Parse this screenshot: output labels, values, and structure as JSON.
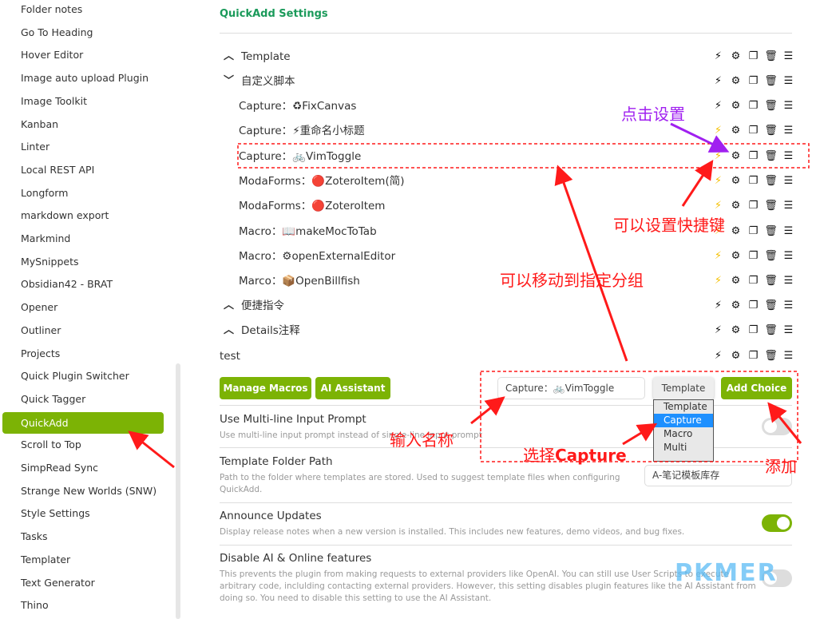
{
  "sidebar": {
    "items": [
      "Folder notes",
      "Go To Heading",
      "Hover Editor",
      "Image auto upload Plugin",
      "Image Toolkit",
      "Kanban",
      "Linter",
      "Local REST API",
      "Longform",
      "markdown export",
      "Markmind",
      "MySnippets",
      "Obsidian42 - BRAT",
      "Opener",
      "Outliner",
      "Projects",
      "Quick Plugin Switcher",
      "Quick Tagger",
      "QuickAdd",
      "Scroll to Top",
      "SimpRead Sync",
      "Strange New Worlds (SNW)",
      "Style Settings",
      "Tasks",
      "Templater",
      "Text Generator",
      "Thino"
    ],
    "active": "QuickAdd"
  },
  "main": {
    "title": "QuickAdd Settings",
    "choices": [
      {
        "chev": "^",
        "label": "Template"
      },
      {
        "chev": "v",
        "label": "自定义脚本"
      },
      {
        "label": "Capture：",
        "emoji": "♻",
        "name": "FixCanvas"
      },
      {
        "label": "Capture：",
        "emoji": "⚡",
        "name": "重命名小标题"
      },
      {
        "label": "Capture：",
        "emoji": "🚲",
        "name": "VimToggle"
      },
      {
        "label": "ModaForms：",
        "emoji": "🔴",
        "name": "ZoteroItem(简)"
      },
      {
        "label": "ModaForms：",
        "emoji": "🔴",
        "name": "ZoteroItem"
      },
      {
        "label": "Macro：",
        "emoji": "📖",
        "name": "makeMocToTab"
      },
      {
        "label": "Macro：",
        "emoji": "⚙",
        "name": "openExternalEditor"
      },
      {
        "label": "Marco：",
        "emoji": "📦",
        "name": "OpenBillfish"
      },
      {
        "chev": "^",
        "label": "便捷指令"
      },
      {
        "chev": "^",
        "label": "Details注释"
      },
      {
        "label": "test"
      }
    ],
    "buttons": {
      "manage_macros": "Manage Macros",
      "ai_assistant": "AI Assistant",
      "add_choice": "Add Choice"
    },
    "choice_name_value": "Capture：🚲VimToggle",
    "type_select": {
      "value": "Template",
      "options": [
        "Template",
        "Capture",
        "Macro",
        "Multi"
      ],
      "highlighted": "Capture"
    },
    "settings": [
      {
        "name": "Use Multi-line Input Prompt",
        "desc": "Use multi-line input prompt instead of single-line input prompt",
        "toggle": false
      },
      {
        "name": "Template Folder Path",
        "desc": "Path to the folder where templates are stored. Used to suggest template files when configuring QuickAdd.",
        "value": "A-笔记模板库存"
      },
      {
        "name": "Announce Updates",
        "desc": "Display release notes when a new version is installed. This includes new features, demo videos, and bug fixes.",
        "toggle": true
      },
      {
        "name": "Disable AI & Online features",
        "desc": "This prevents the plugin from making requests to external providers like OpenAI. You can still use User Scripts to execute arbitrary code, inclulding contacting external providers. However, this setting disables plugin features like the AI Assistant from doing so. You need to disable this setting to use the AI Assistant.",
        "toggle": false
      }
    ]
  },
  "annotations": {
    "click_settings": "点击设置",
    "set_hotkey": "可以设置快捷键",
    "move_group": "可以移动到指定分组",
    "enter_name": "输入名称",
    "select_capture_cn": "选择",
    "select_capture_en": "Capture",
    "add": "添加"
  },
  "watermark": "PKMER",
  "colors": {
    "accent": "#7cb305",
    "title": "#1a9a5a",
    "annotation": "#ff1a1a",
    "annotation_purple": "#a020f0"
  }
}
